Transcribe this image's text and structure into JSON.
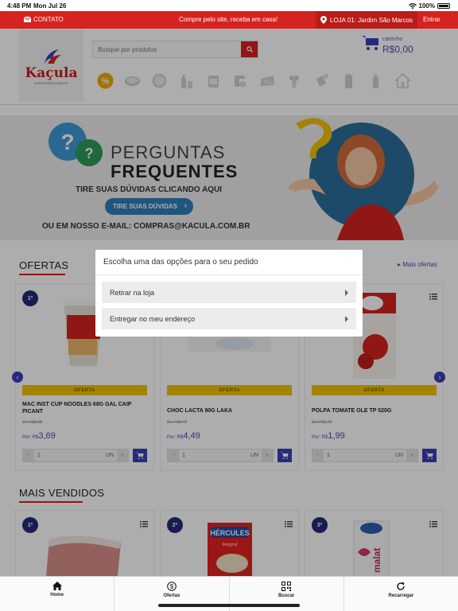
{
  "status": {
    "time": "4:48 PM",
    "date": "Mon Jul 26",
    "battery": "100%"
  },
  "topbar": {
    "contato": "CONTATO",
    "promo": "Compre pelo site, receba em casa!",
    "loja": "LOJA 01: Jardim São Marcos",
    "entrar": "Entrar"
  },
  "header": {
    "logo": "Kaçula",
    "logo_sub": "SUPERMERCADOS",
    "search_placeholder": "Busque por produtos",
    "cart_label": "carrinho",
    "cart_value": "R$0,00",
    "categories": [
      "percent-icon",
      "meat-icon",
      "rice-icon",
      "bottle-icon",
      "can-icon",
      "mixer-icon",
      "cheese-icon",
      "grapes-icon",
      "cleaning-icon",
      "juice-icon",
      "milk-icon",
      "house-icon"
    ]
  },
  "banner": {
    "line1": "PERGUNTAS",
    "line2": "FREQUENTES",
    "sub": "TIRE SUAS DÚVIDAS CLICANDO AQUI",
    "button": "TIRE SUAS DÚVIDAS",
    "email": "OU EM NOSSO E-MAIL: COMPRAS@KACULA.COM.BR"
  },
  "ofertas": {
    "title": "OFERTAS",
    "more": "Mais ofertas",
    "products": [
      {
        "rank": "1º",
        "strip": "OFERTA",
        "name": "MAC INST CUP NOODLES 68G GAL CAIP PICANT",
        "old": "De: R$3,99",
        "por": "Por: R$",
        "price": "3,69",
        "qty": "1",
        "unit": "UN"
      },
      {
        "rank": "",
        "strip": "OFERTA",
        "name": "CHOC LACTA 90G LAKA",
        "old": "De: R$5,49",
        "por": "Por: R$",
        "price": "4,49",
        "qty": "1",
        "unit": "UN"
      },
      {
        "rank": "",
        "strip": "OFERTA",
        "name": "POLPA TOMATE OLE TP 520G",
        "old": "De: R$2,49",
        "por": "Por: R$",
        "price": "1,99",
        "qty": "1",
        "unit": "UN"
      }
    ]
  },
  "mais_vendidos": {
    "title": "MAIS VENDIDOS",
    "ranks": [
      "1º",
      "2º",
      "3º"
    ],
    "img_text_2": "HÉRCULES",
    "img_text_2b": "Integral",
    "img_text_3": "malat"
  },
  "modal": {
    "title": "Escolha uma das opções para o seu pedido",
    "options": [
      "Retirar na loja",
      "Entregar no meu endereço"
    ]
  },
  "tabs": [
    {
      "label": "Home",
      "icon": "home-icon"
    },
    {
      "label": "Ofertas",
      "icon": "dollar-icon"
    },
    {
      "label": "Buscar",
      "icon": "qrcode-icon"
    },
    {
      "label": "Recarregar",
      "icon": "reload-icon"
    }
  ],
  "colors": {
    "brand_red": "#d6231f",
    "accent_blue": "#3a3fb5",
    "offer_yellow": "#f2c200"
  }
}
